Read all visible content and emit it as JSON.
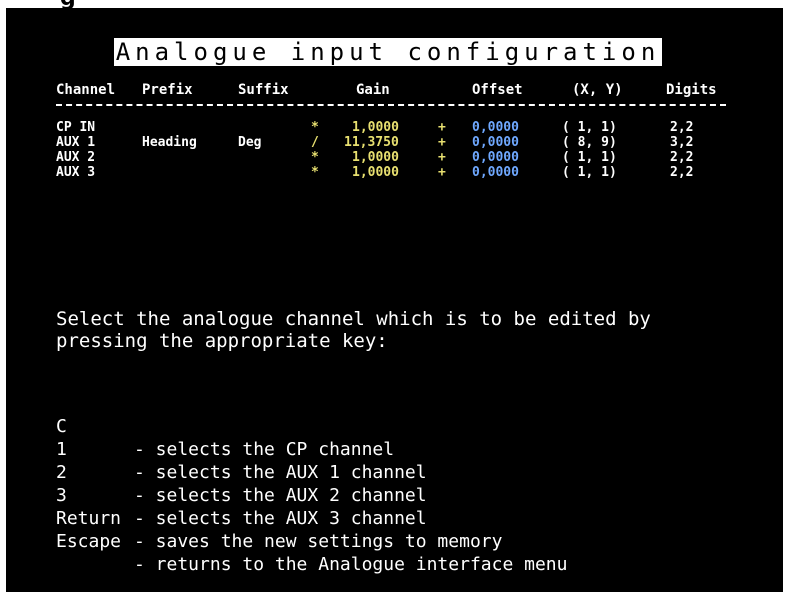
{
  "top_fragment": "g",
  "title": "Analogue input configuration",
  "table": {
    "headers": [
      "Channel",
      "Prefix",
      "Suffix",
      "Gain",
      "Offset",
      "(X, Y)",
      "Digits"
    ],
    "rows": [
      {
        "channel": "CP IN",
        "prefix": "",
        "suffix": "",
        "op": "*",
        "gain": "1,0000",
        "plus": "+",
        "offset": "0,0000",
        "xy": "( 1,  1)",
        "digits": "2,2"
      },
      {
        "channel": "AUX 1",
        "prefix": "Heading",
        "suffix": "Deg",
        "op": "/",
        "gain": "11,3750",
        "plus": "+",
        "offset": "0,0000",
        "xy": "( 8,  9)",
        "digits": "3,2"
      },
      {
        "channel": "AUX 2",
        "prefix": "",
        "suffix": "",
        "op": "*",
        "gain": "1,0000",
        "plus": "+",
        "offset": "0,0000",
        "xy": "( 1,  1)",
        "digits": "2,2"
      },
      {
        "channel": "AUX 3",
        "prefix": "",
        "suffix": "",
        "op": "*",
        "gain": "1,0000",
        "plus": "+",
        "offset": "0,0000",
        "xy": "( 1,  1)",
        "digits": "2,2"
      }
    ]
  },
  "instructions": [
    "Select the analogue channel which is to be edited by",
    "pressing the appropriate key:"
  ],
  "keys": [
    {
      "key": "C",
      "desc": "- selects the CP channel"
    },
    {
      "key": "1",
      "desc": "- selects the AUX 1 channel"
    },
    {
      "key": "2",
      "desc": "- selects the AUX 2 channel"
    },
    {
      "key": "3",
      "desc": "- selects the AUX 3 channel"
    },
    {
      "key": "Return",
      "desc": "- saves the new settings to memory"
    },
    {
      "key": "Escape",
      "desc": "- returns to the Analogue interface menu"
    }
  ],
  "colors": {
    "gain_color": "#e8e070",
    "offset_color": "#6fa8ff",
    "screen_bg": "#000000"
  }
}
